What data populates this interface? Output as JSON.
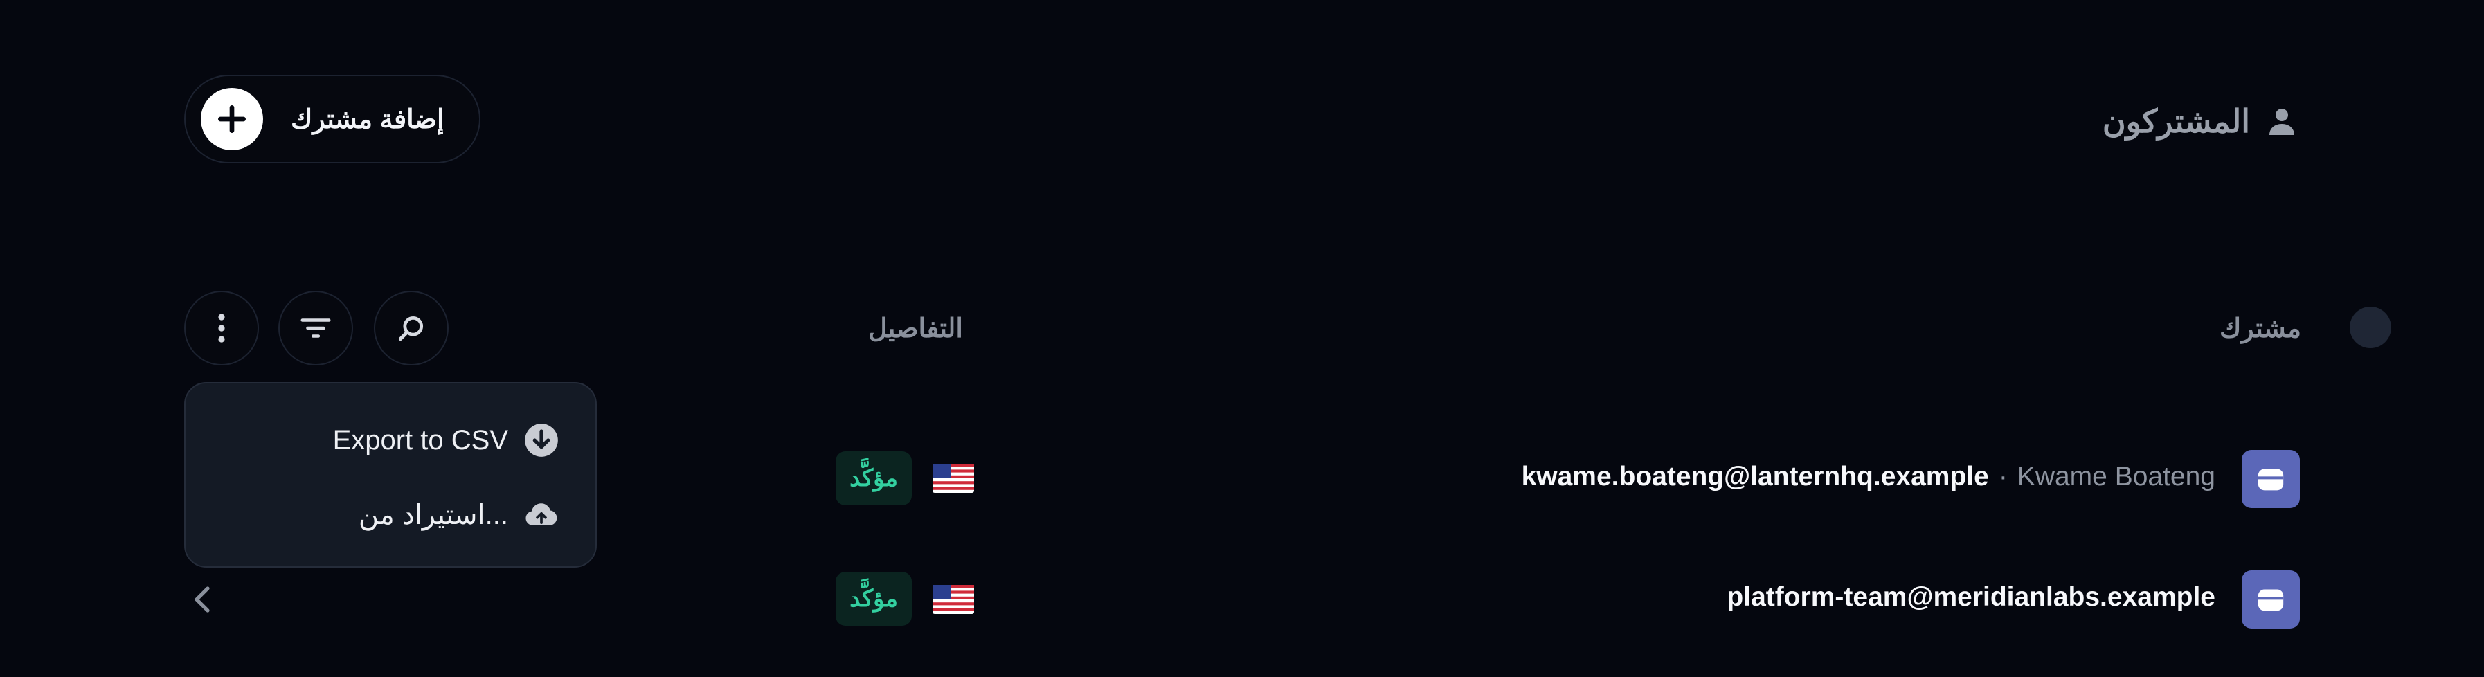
{
  "header": {
    "title": "المشتركون",
    "title_icon": "user-icon",
    "add_button_label": "إضافة مشترك",
    "add_button_icon": "plus-icon"
  },
  "toolbar": {
    "buttons": [
      "search-icon",
      "filter-icon",
      "more-vertical-icon"
    ]
  },
  "table": {
    "columns": {
      "subscriber": "مشترك",
      "details": "التفاصيل"
    },
    "rows": [
      {
        "email": "kwame.boateng@lanternhq.example",
        "separator": "·",
        "name": "Kwame Boateng",
        "country_flag": "us-flag",
        "status": "مؤكَّد"
      },
      {
        "email": "platform-team@meridianlabs.example",
        "separator": "",
        "name": "",
        "country_flag": "us-flag",
        "status": "مؤكَّد"
      }
    ]
  },
  "menu": {
    "items": [
      {
        "label": "Export to CSV",
        "icon": "download-circle-icon"
      },
      {
        "label": "استيراد من...",
        "icon": "cloud-upload-icon"
      }
    ]
  },
  "colors": {
    "background": "#05070f",
    "avatar": "#5b67b8",
    "badge_bg": "#0b2420",
    "badge_text": "#33d0a0",
    "menu_bg": "#141a25"
  }
}
